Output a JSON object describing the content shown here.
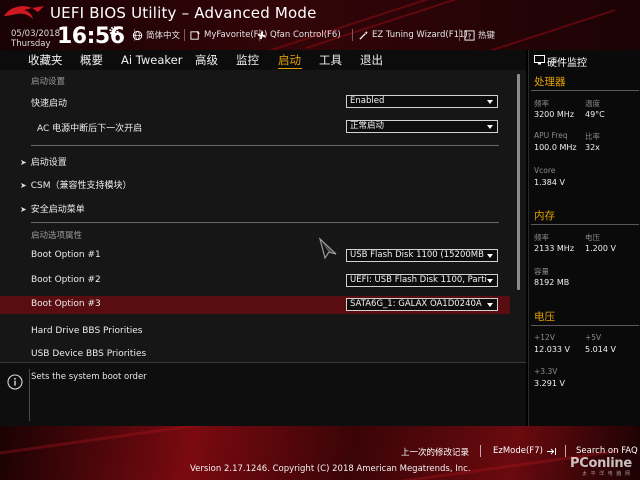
{
  "header": {
    "title": "UEFI BIOS Utility – Advanced Mode",
    "date": "05/03/2018",
    "day": "Thursday",
    "time": "16:56",
    "links": [
      {
        "label": "简体中文",
        "icon": "globe-icon"
      },
      {
        "label": "MyFavorite(F3)",
        "icon": "favorite-icon"
      },
      {
        "label": "Qfan Control(F6)",
        "icon": "fan-icon"
      },
      {
        "label": "EZ Tuning Wizard(F11)",
        "icon": "wizard-icon"
      },
      {
        "label": "热键",
        "icon": "hotkey-icon"
      }
    ]
  },
  "menu": {
    "tabs": [
      "收藏夹",
      "概要",
      "Ai Tweaker",
      "高级",
      "监控",
      "启动",
      "工具",
      "退出"
    ],
    "active": "启动"
  },
  "main": {
    "section_boot_config": "启动设置",
    "fast_boot_label": "快速启动",
    "fast_boot_value": "Enabled",
    "ac_power_label": "AC 电源中断后下一次开启",
    "ac_power_value": "正常启动",
    "submenus": [
      "启动设置",
      "CSM（兼容性支持模块）",
      "安全启动菜单"
    ],
    "section_boot_priority": "启动选项属性",
    "boot_options": [
      {
        "label": "Boot Option #1",
        "value": "USB Flash Disk 1100  (15200MB"
      },
      {
        "label": "Boot Option #2",
        "value": "UEFI: USB Flash Disk 1100, Parti"
      },
      {
        "label": "Boot Option #3",
        "value": "SATA6G_1: GALAX OA1D0240A"
      }
    ],
    "hdd_bbs": "Hard Drive BBS Priorities",
    "usb_bbs": "USB Device BBS Priorities"
  },
  "help": {
    "text": "Sets the system boot order"
  },
  "hardware_monitor": {
    "title": "硬件监控",
    "cpu": {
      "heading": "处理器",
      "freq_label": "频率",
      "freq_value": "3200 MHz",
      "temp_label": "温度",
      "temp_value": "49°C",
      "apu_label": "APU Freq",
      "apu_value": "100.0 MHz",
      "ratio_label": "比率",
      "ratio_value": "32x",
      "vcore_label": "Vcore",
      "vcore_value": "1.384 V"
    },
    "memory": {
      "heading": "内存",
      "freq_label": "频率",
      "freq_value": "2133 MHz",
      "volt_label": "电压",
      "volt_value": "1.200 V",
      "cap_label": "容量",
      "cap_value": "8192 MB"
    },
    "voltage": {
      "heading": "电压",
      "v12_label": "+12V",
      "v12_value": "12.033 V",
      "v5_label": "+5V",
      "v5_value": "5.014 V",
      "v33_label": "+3.3V",
      "v33_value": "3.291 V"
    }
  },
  "footer": {
    "last_modified": "上一次的修改记录",
    "ezmode": "EzMode(F7)",
    "search_faq": "Search on FAQ",
    "copyright": "Version 2.17.1246. Copyright (C) 2018 American Megatrends, Inc.",
    "watermark": "PConline",
    "watermark_sub": "太 平 洋 电 脑 网"
  },
  "colors": {
    "accent": "#e0a000",
    "selection": "#5a0d10",
    "brand_red": "#8c0d14"
  }
}
